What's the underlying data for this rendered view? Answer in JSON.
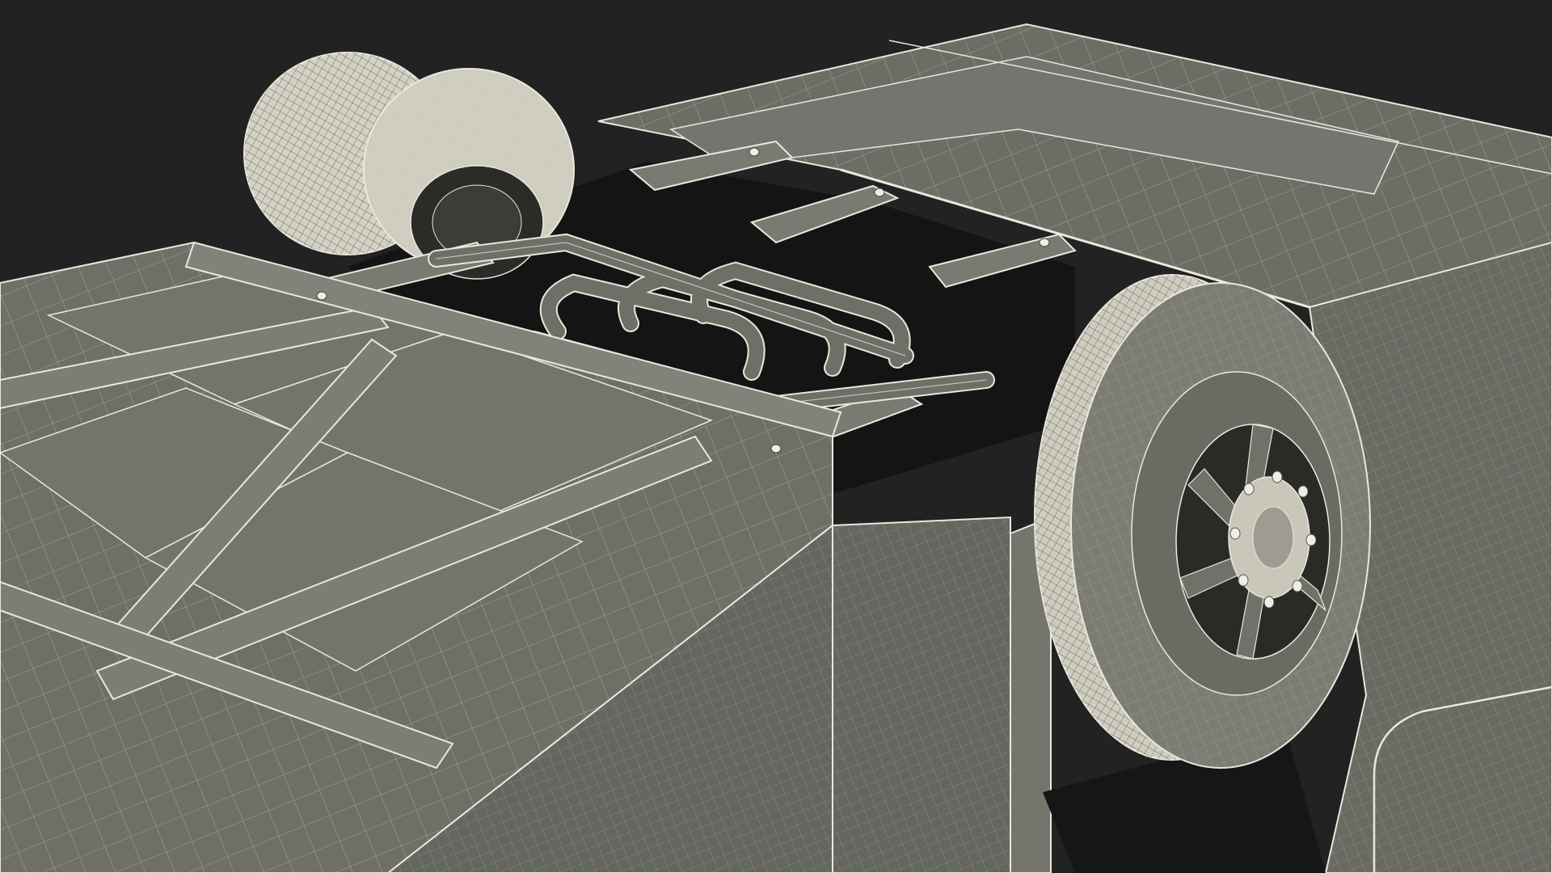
{
  "scene": {
    "subject": "wireframe-3d-render-vehicle-undercarriage",
    "colors": {
      "background": "#222222",
      "surface": "#6f6f67",
      "surface_light": "#7c7c73",
      "surface_dark": "#585851",
      "wire": "#e9e8dd",
      "shadow": "#101010",
      "tire": "#d8d6c8",
      "tire_dark": "#8f8e84"
    },
    "components": [
      "floor-panels",
      "cross-frame",
      "rear-tire",
      "front-tire",
      "wheel-hub",
      "lug-nuts",
      "exhaust-pipes",
      "side-wall",
      "wheel-arch"
    ]
  }
}
